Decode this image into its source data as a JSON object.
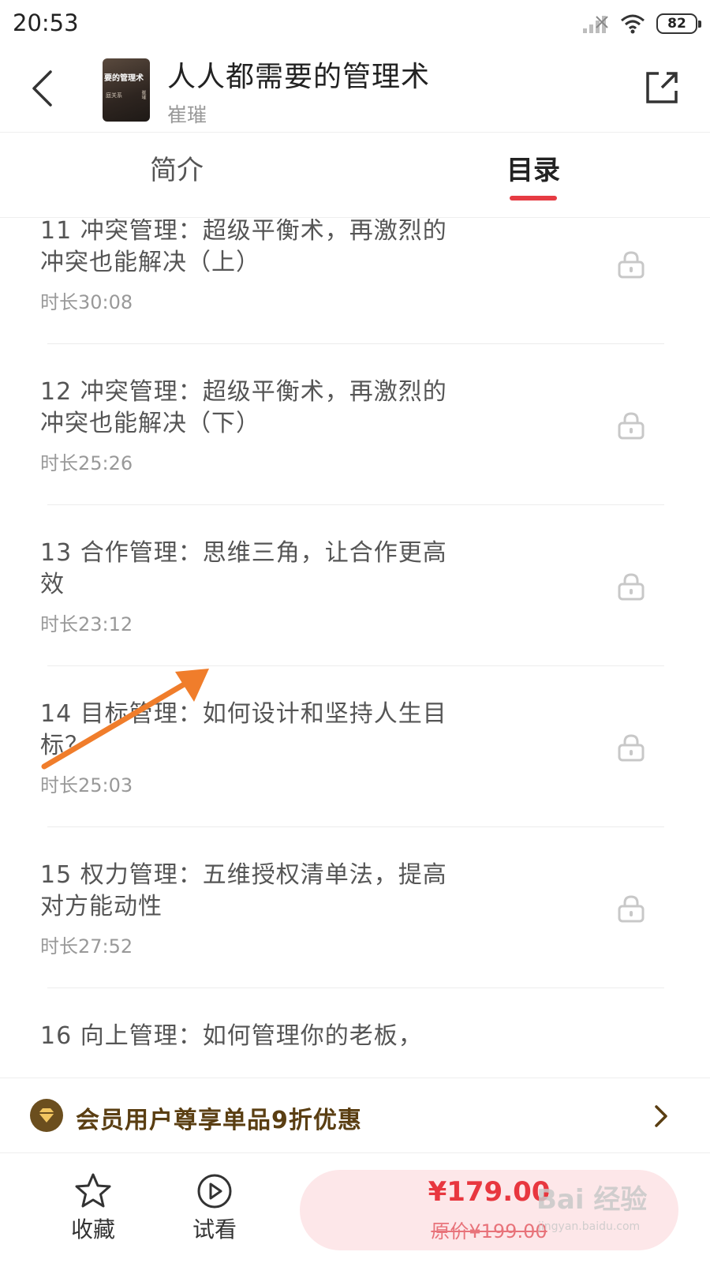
{
  "status_bar": {
    "time": "20:53",
    "battery": "82"
  },
  "header": {
    "title": "人人都需要的管理术",
    "author": "崔璀",
    "cover": {
      "title": "要的管理术",
      "subtitle": "庭关系",
      "side_text": "崔璀"
    }
  },
  "tabs": [
    {
      "label": "简介",
      "active": false
    },
    {
      "label": "目录",
      "active": true
    }
  ],
  "chapters": [
    {
      "title": "11 冲突管理：超级平衡术，再激烈的冲突也能解决（上）",
      "duration": "时长30:08",
      "locked": true
    },
    {
      "title": "12 冲突管理：超级平衡术，再激烈的冲突也能解决（下）",
      "duration": "时长25:26",
      "locked": true
    },
    {
      "title": "13 合作管理：思维三角，让合作更高效",
      "duration": "时长23:12",
      "locked": true
    },
    {
      "title": "14 目标管理：如何设计和坚持人生目标？",
      "duration": "时长25:03",
      "locked": true
    },
    {
      "title": "15 权力管理：五维授权清单法，提高对方能动性",
      "duration": "时长27:52",
      "locked": true
    },
    {
      "title": "16 向上管理：如何管理你的老板，",
      "duration": "",
      "locked": true
    }
  ],
  "promo": {
    "text": "会员用户尊享单品9折优惠"
  },
  "bottom_bar": {
    "favorite_label": "收藏",
    "trial_label": "试看",
    "price": "¥179.00",
    "original_price": "原价¥199.00"
  },
  "watermark": {
    "text": "Bai 经验",
    "sub": "jingyan.baidu.com"
  },
  "colors": {
    "accent": "#e63b43",
    "promo": "#5a3e12",
    "text_secondary": "#999999"
  }
}
